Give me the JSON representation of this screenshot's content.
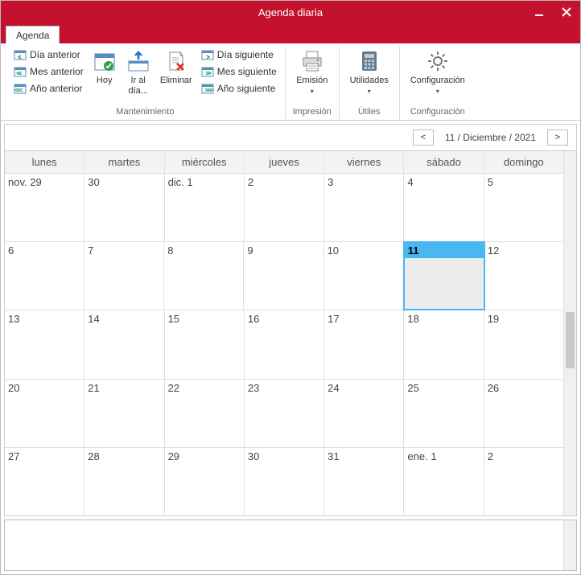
{
  "window": {
    "title": "Agenda diaria"
  },
  "tabs": {
    "agenda": "Agenda"
  },
  "ribbon": {
    "mantenimiento": {
      "label": "Mantenimiento",
      "dia_anterior": "Día anterior",
      "mes_anterior": "Mes anterior",
      "ano_anterior": "Año anterior",
      "hoy": "Hoy",
      "ir_al_dia": "Ir al día...",
      "eliminar": "Eliminar",
      "dia_siguiente": "Día siguiente",
      "mes_siguiente": "Mes siguiente",
      "ano_siguiente": "Año siguiente"
    },
    "impresion": {
      "label": "Impresión",
      "emision": "Emisión"
    },
    "utiles": {
      "label": "Útiles",
      "utilidades": "Utilidades"
    },
    "configuracion": {
      "label": "Configuración",
      "configuracion": "Configuración"
    }
  },
  "header": {
    "prev": "<",
    "next": ">",
    "current": "11 / Diciembre / 2021"
  },
  "weekdays": [
    "lunes",
    "martes",
    "miércoles",
    "jueves",
    "viernes",
    "sábado",
    "domingo"
  ],
  "weeks": [
    [
      "nov. 29",
      "30",
      "dic. 1",
      "2",
      "3",
      "4",
      "5"
    ],
    [
      "6",
      "7",
      "8",
      "9",
      "10",
      "11",
      "12"
    ],
    [
      "13",
      "14",
      "15",
      "16",
      "17",
      "18",
      "19"
    ],
    [
      "20",
      "21",
      "22",
      "23",
      "24",
      "25",
      "26"
    ],
    [
      "27",
      "28",
      "29",
      "30",
      "31",
      "ene. 1",
      "2"
    ]
  ],
  "selected": {
    "week": 1,
    "day": 5
  },
  "notes": {
    "value": ""
  }
}
